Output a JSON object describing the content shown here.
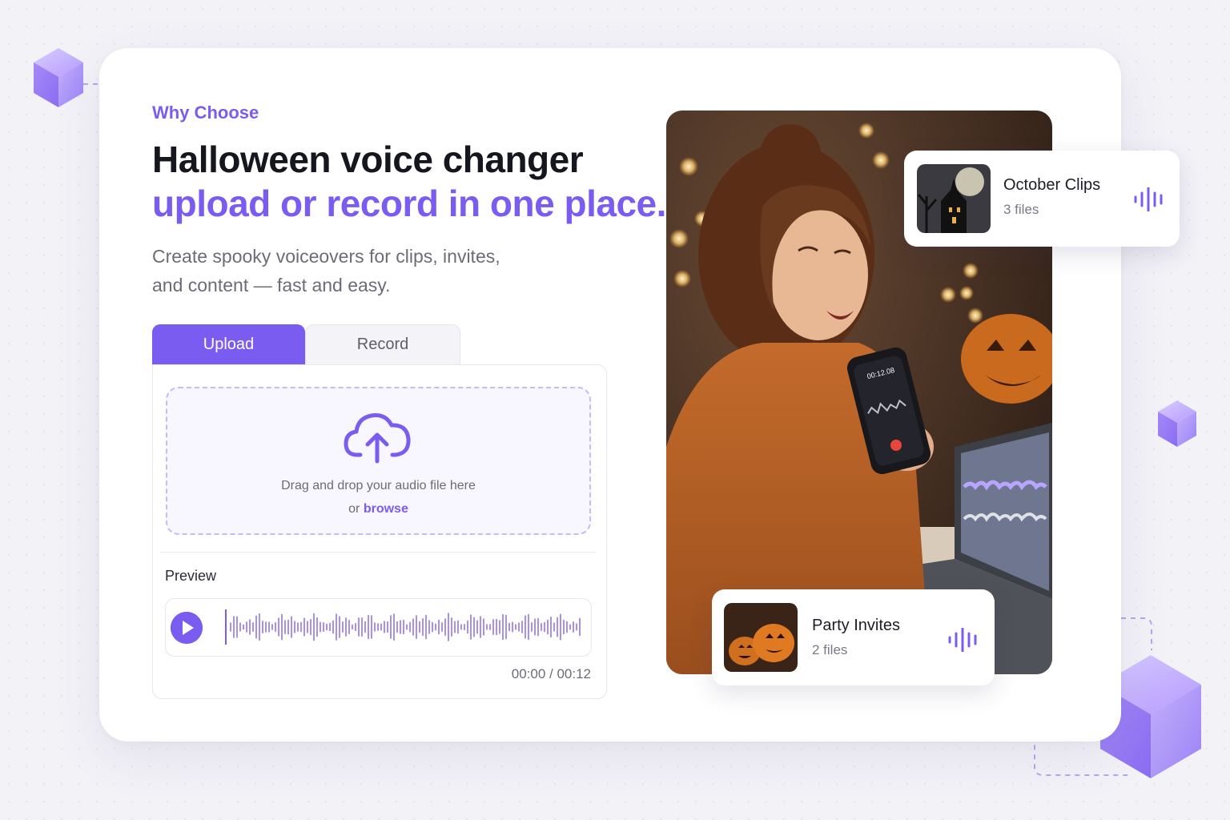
{
  "hero": {
    "eyebrow": "Why Choose",
    "title_line1": "Halloween voice changer",
    "title_line2": "upload or record in one place.",
    "subtitle_line1": "Create spooky voiceovers for clips, invites,",
    "subtitle_line2": "and content — fast and easy."
  },
  "tabs": [
    {
      "label": "Upload",
      "active": true
    },
    {
      "label": "Record",
      "active": false
    }
  ],
  "dropzone": {
    "text": "Drag and drop your audio file here",
    "or_text": "or",
    "browse_label": "browse",
    "icon": "cloud-upload-icon"
  },
  "preview": {
    "label": "Preview",
    "time": "00:00 / 00:12"
  },
  "phone_screen": {
    "timer": "00:12.08"
  },
  "cards": [
    {
      "title": "October Clips",
      "count": "3 files",
      "icon": "audio-bars-icon"
    },
    {
      "title": "Party Invites",
      "count": "2 files",
      "icon": "audio-bars-icon"
    }
  ],
  "colors": {
    "accent": "#7b5cf0",
    "background": "#f3f2f7"
  }
}
